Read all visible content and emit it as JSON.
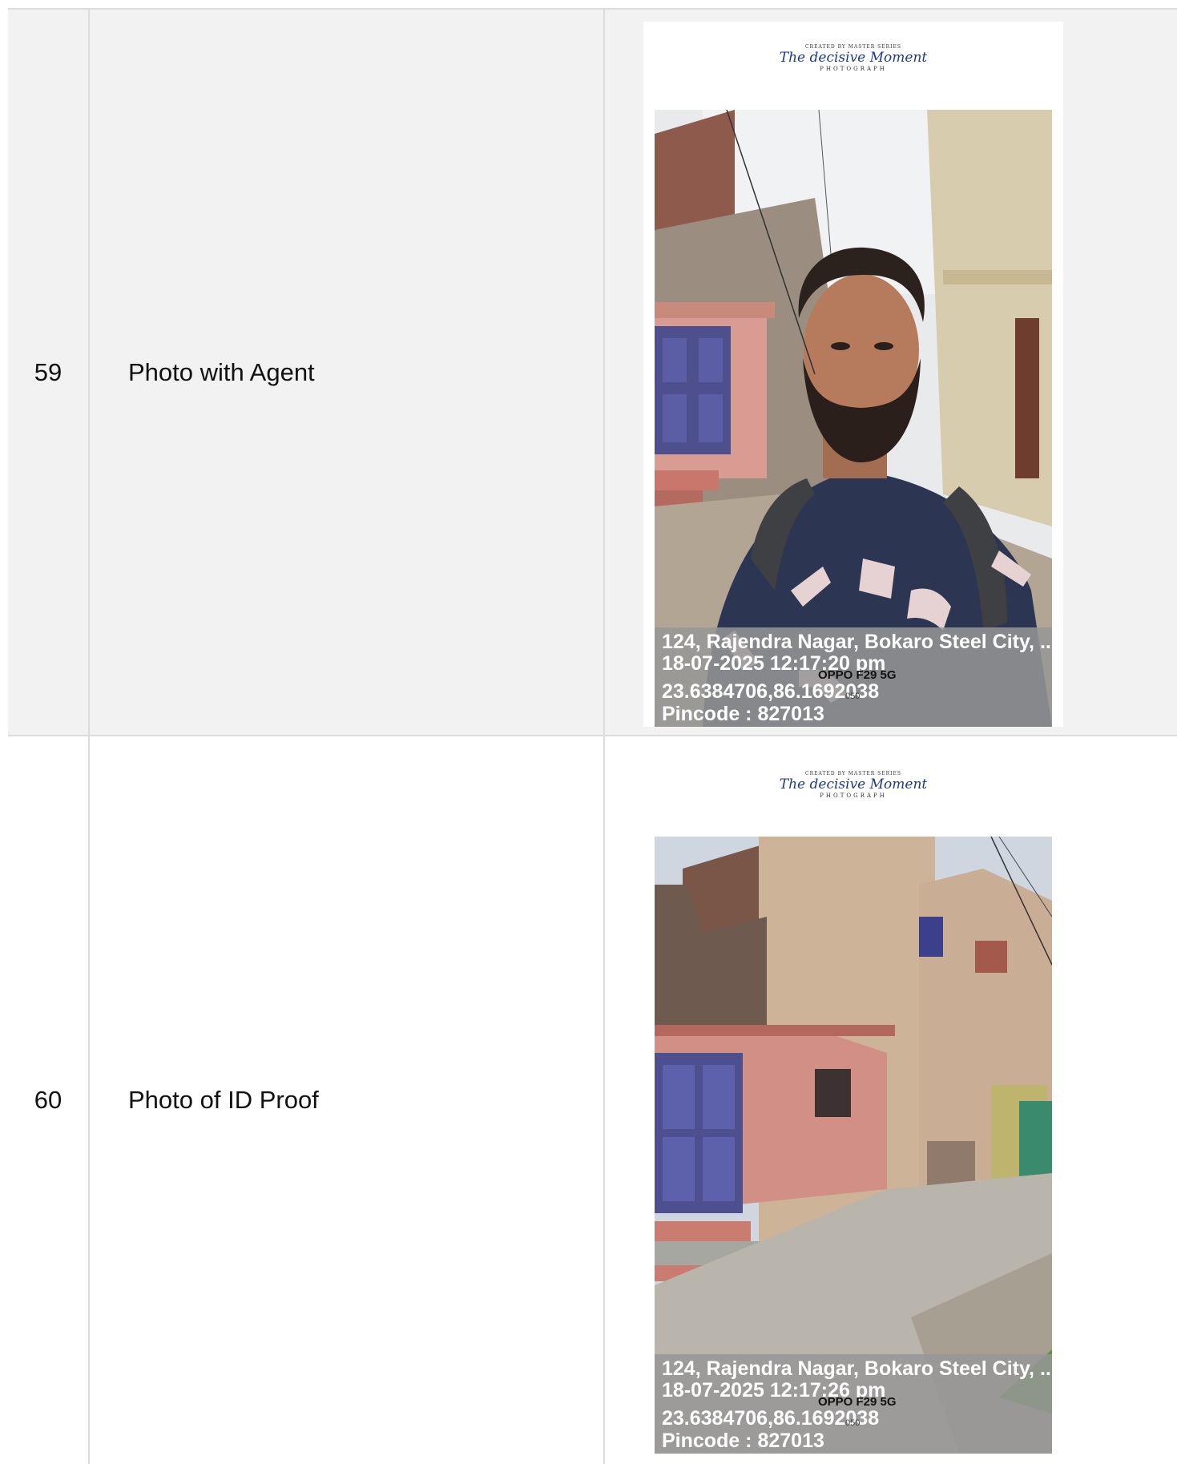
{
  "rows": [
    {
      "number": "59",
      "label": "Photo with Agent",
      "photo": {
        "brand_top": "CREATED BY MASTER SERIES",
        "brand_script": "The decisive Moment",
        "brand_sub": "PHOTOGRAPH",
        "address": "124, Rajendra Nagar, Bokaro Steel City, ...",
        "datetime": "18-07-2025 12:17:20 pm",
        "device": "OPPO F29 5G",
        "shot_info": "050",
        "coordinates": "23.6384706,86.1692038",
        "pincode": "Pincode : 827013"
      }
    },
    {
      "number": "60",
      "label": "Photo of ID Proof",
      "photo": {
        "brand_top": "CREATED BY MASTER SERIES",
        "brand_script": "The decisive Moment",
        "brand_sub": "PHOTOGRAPH",
        "address": "124, Rajendra Nagar, Bokaro Steel City, ...",
        "datetime": "18-07-2025 12:17:26 pm",
        "device": "OPPO F29 5G",
        "shot_info": "050",
        "coordinates": "23.6384706,86.1692038",
        "pincode": "Pincode : 827013"
      }
    }
  ]
}
